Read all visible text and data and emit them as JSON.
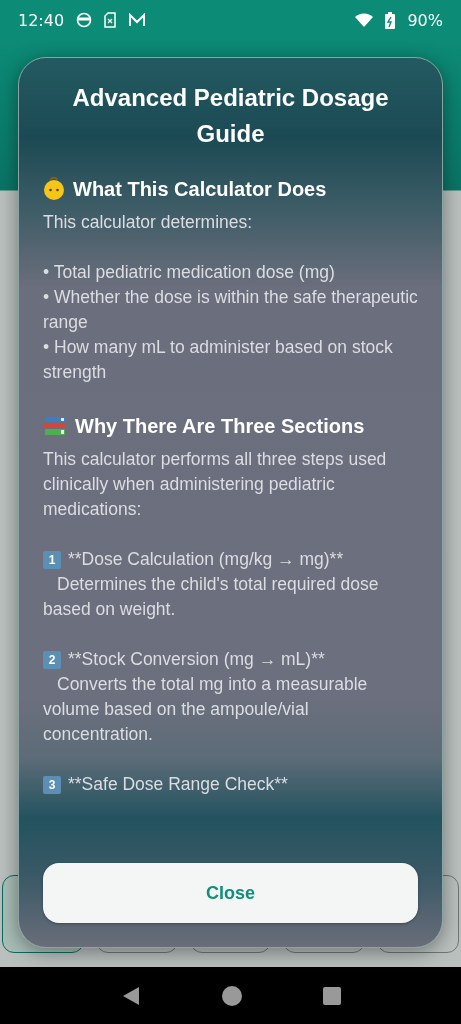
{
  "status_bar": {
    "time": "12:40",
    "battery": "90%"
  },
  "bottom_tabs": [
    {
      "selected": true
    },
    {
      "selected": false
    },
    {
      "selected": false
    },
    {
      "selected": false
    },
    {
      "selected": false
    }
  ],
  "dialog": {
    "title": "Advanced Pediatric Dosage Guide",
    "sections": [
      {
        "kind": "baby",
        "heading": "What This Calculator Does",
        "blocks": [
          {
            "kind": "text",
            "lines": [
              "This calculator determines:"
            ]
          },
          {
            "kind": "text",
            "lines": [
              "• Total pediatric medication dose (mg)",
              "• Whether the dose is within the safe therapeutic range",
              "• How many mL to administer based on stock strength"
            ]
          }
        ]
      },
      {
        "kind": "books",
        "heading": "Why There Are Three Sections",
        "blocks": [
          {
            "kind": "text",
            "lines": [
              "This calculator performs all three steps used clinically when administering pediatric medications:"
            ]
          },
          {
            "kind": "step",
            "number": "1",
            "title": "**Dose Calculation (mg/kg → mg)**",
            "text": "Determines the child's total required dose based on weight."
          },
          {
            "kind": "step",
            "number": "2",
            "title": "**Stock Conversion (mg → mL)**",
            "text": "Converts the total mg into a measurable volume based on the ampoule/vial concentration."
          },
          {
            "kind": "step",
            "number": "3",
            "title": "**Safe Dose Range Check**"
          }
        ]
      }
    ],
    "button": "Close"
  }
}
